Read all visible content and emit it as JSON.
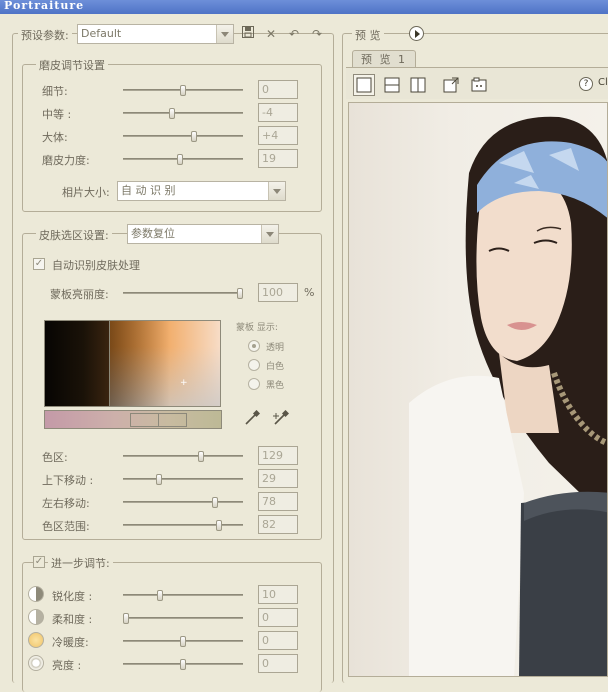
{
  "window": {
    "title": "Portraiture"
  },
  "preset": {
    "label": "预设参数:",
    "value": "Default",
    "icons": [
      "save-icon",
      "delete-icon",
      "undo-icon",
      "redo-icon"
    ]
  },
  "smoothing": {
    "title": "磨皮调节设置",
    "sliders": [
      {
        "label": "细节:",
        "value": "0",
        "level": 0.5
      },
      {
        "label": "中等 :",
        "value": "-4",
        "level": 0.4
      },
      {
        "label": "大体:",
        "value": "+4",
        "level": 0.6
      },
      {
        "label": "磨皮力度:",
        "value": "19",
        "level": 0.47
      }
    ],
    "size_label": "相片大小:",
    "size_value": "自 动 识 别"
  },
  "skin_mask": {
    "title": "皮肤选区设置:",
    "preset_value": "参数复位",
    "auto_label": "自动识别皮肤处理",
    "auto_checked": true,
    "brightness": {
      "label": "蒙板亮丽度:",
      "value": "100",
      "unit": "%",
      "level": 1.0
    },
    "mask_display": {
      "title": "蒙板 显示:",
      "options": [
        {
          "label": "透明",
          "checked": true
        },
        {
          "label": "白色",
          "checked": false
        },
        {
          "label": "黑色",
          "checked": false
        }
      ]
    },
    "picker_icons": [
      "eyedropper-icon",
      "eyedropper-plus-icon"
    ],
    "sliders": [
      {
        "label": "色区:",
        "value": "129",
        "level": 0.66
      },
      {
        "label": "上下移动 :",
        "value": "29",
        "level": 0.29
      },
      {
        "label": "左右移动:",
        "value": "78",
        "level": 0.78
      },
      {
        "label": "色区范围:",
        "value": "82",
        "level": 0.82
      }
    ],
    "colors": {
      "swatch_dark": "#1a1208",
      "swatch_orange": "#e98a2a",
      "hue_bar_left": "#c49aa8",
      "hue_bar_right": "#bdb996"
    }
  },
  "enhance": {
    "title": "进一步调节:",
    "checked": true,
    "sliders": [
      {
        "label": "锐化度 :",
        "value": "10",
        "level": 0.3,
        "icon": "sharpness-icon"
      },
      {
        "label": "柔和度 :",
        "value": "0",
        "level": 0.0,
        "icon": "softness-icon"
      },
      {
        "label": "冷暖度:",
        "value": "0",
        "level": 0.5,
        "icon": "warmth-icon"
      },
      {
        "label": "亮度 :",
        "value": "0",
        "level": 0.5,
        "icon": "brightness-icon"
      }
    ]
  },
  "preview": {
    "label": "预 览",
    "tab": "预 览 1",
    "tools": [
      "single-view-icon",
      "split-horizontal-icon",
      "split-vertical-icon",
      "export-icon",
      "compare-icon"
    ],
    "help_icon": "help-icon",
    "help_text": "Cl"
  }
}
